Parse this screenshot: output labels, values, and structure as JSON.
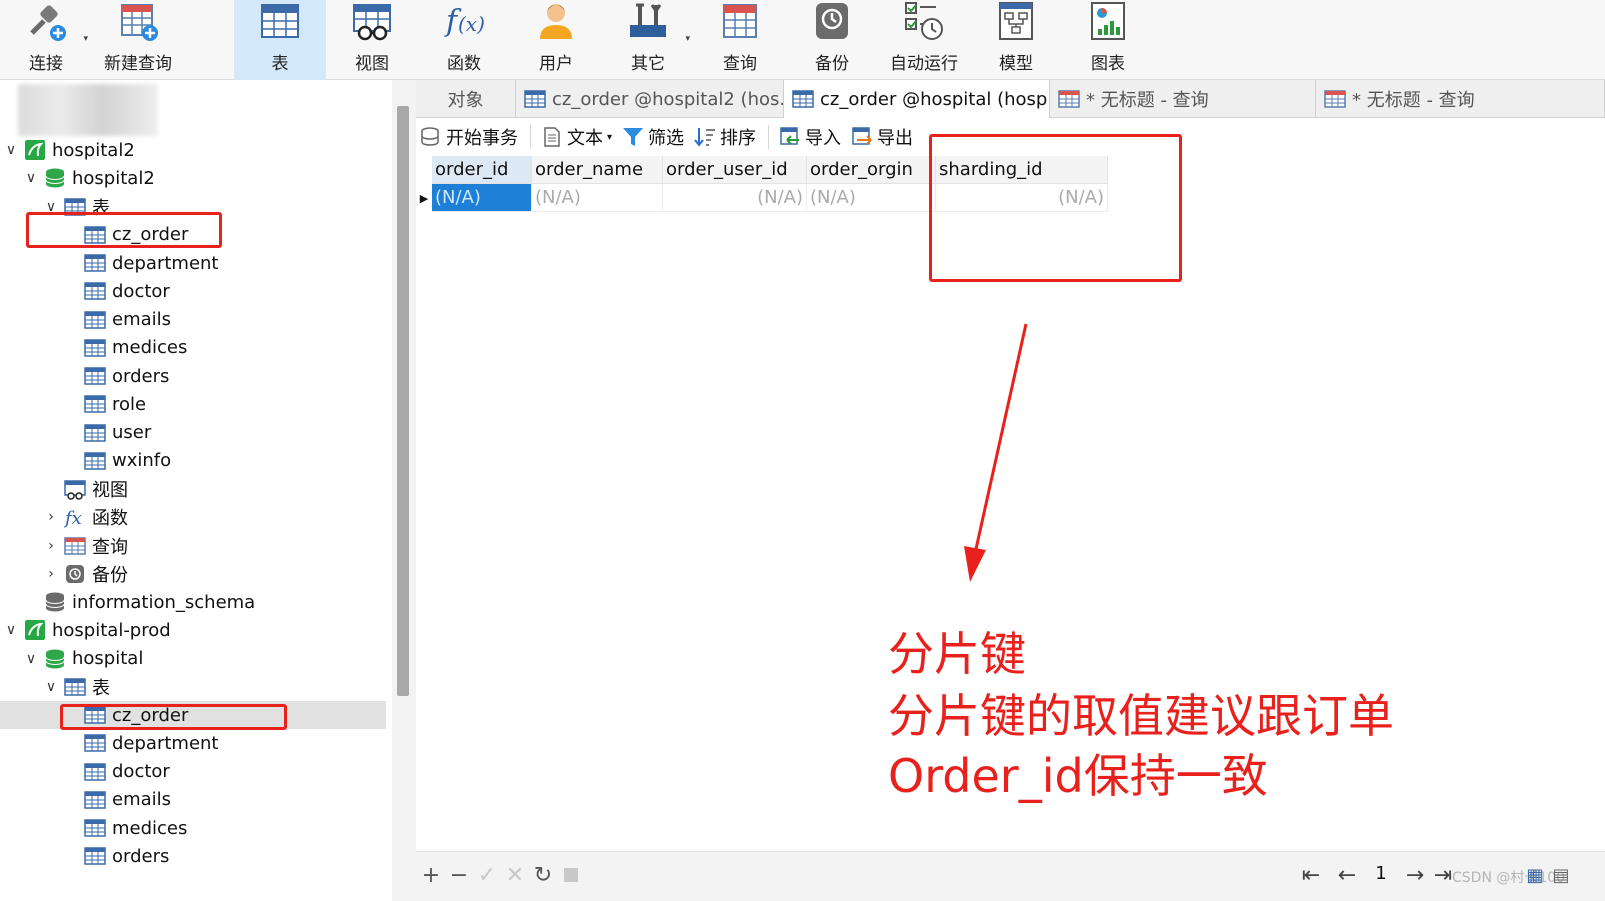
{
  "toolbar": {
    "buttons": [
      {
        "label": "连接",
        "icon": "connection-icon"
      },
      {
        "label": "新建查询",
        "icon": "new-query-icon"
      },
      {
        "label": "表",
        "icon": "table-icon"
      },
      {
        "label": "视图",
        "icon": "view-icon"
      },
      {
        "label": "函数",
        "icon": "function-icon"
      },
      {
        "label": "用户",
        "icon": "user-icon"
      },
      {
        "label": "其它",
        "icon": "tools-icon"
      },
      {
        "label": "查询",
        "icon": "query-icon"
      },
      {
        "label": "备份",
        "icon": "backup-icon"
      },
      {
        "label": "自动运行",
        "icon": "schedule-icon"
      },
      {
        "label": "模型",
        "icon": "model-icon"
      },
      {
        "label": "图表",
        "icon": "chart-icon"
      }
    ],
    "active": "表"
  },
  "sidebar": {
    "conn1": {
      "name": "hospital2",
      "db": "hospital2",
      "tables_label": "表",
      "tables": [
        "cz_order",
        "department",
        "doctor",
        "emails",
        "medices",
        "orders",
        "role",
        "user",
        "wxinfo"
      ],
      "views_label": "视图",
      "functions_label": "函数",
      "queries_label": "查询",
      "backups_label": "备份"
    },
    "info_schema": "information_schema",
    "conn2": {
      "name": "hospital-prod",
      "db": "hospital",
      "tables_label": "表",
      "tables": [
        "cz_order",
        "department",
        "doctor",
        "emails",
        "medices",
        "orders"
      ]
    }
  },
  "tabs": {
    "objects": "对象",
    "items": [
      {
        "label": "cz_order @hospital2 (hos..."
      },
      {
        "label": "cz_order @hospital (hosp..."
      },
      {
        "label": "* 无标题 - 查询"
      },
      {
        "label": "* 无标题 - 查询"
      }
    ]
  },
  "subtoolbar": {
    "begin_tx": "开始事务",
    "text": "文本",
    "filter": "筛选",
    "sort": "排序",
    "import": "导入",
    "export": "导出"
  },
  "grid": {
    "columns": [
      "order_id",
      "order_name",
      "order_user_id",
      "order_orgin",
      "sharding_id"
    ],
    "row": [
      "(N/A)",
      "(N/A)",
      "(N/A)",
      "(N/A)",
      "(N/A)"
    ]
  },
  "statusbar": {
    "page": "1",
    "watermark": "CSDN @村长100"
  },
  "annotation": {
    "line1": "分片键",
    "line2": "分片键的取值建议跟订单",
    "line3": "Order_id保持一致",
    "color": "#e8211c"
  }
}
